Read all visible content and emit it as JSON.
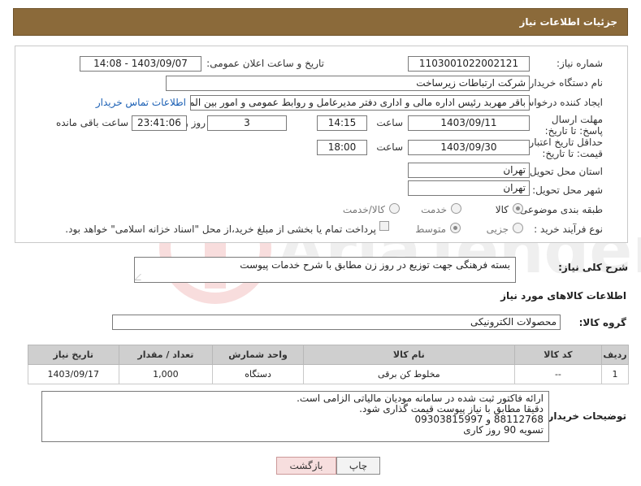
{
  "header": {
    "title": "جزئیات اطلاعات نیاز"
  },
  "form": {
    "need_number_label": "شماره نیاز:",
    "need_number": "1103001022002121",
    "announce_label": "تاریخ و ساعت اعلان عمومی:",
    "announce_value": "1403/09/07 - 14:08",
    "buyer_org_label": "نام دستگاه خریدار:",
    "buyer_org": "شرکت ارتباطات زیرساخت",
    "creator_label": "ایجاد کننده درخواست:",
    "creator": "باقر مهربد رئیس اداره مالی و اداری دفتر مدیرعامل و روابط عمومی و امور بین الم",
    "contact_link": "اطلاعات تماس خریدار",
    "deadline_label": "مهلت ارسال پاسخ: تا تاریخ:",
    "deadline_date": "1403/09/11",
    "time_label": "ساعت",
    "deadline_time": "14:15",
    "days_value": "3",
    "days_label": "روز و",
    "remaining_time": "23:41:06",
    "remaining_label": "ساعت باقی مانده",
    "validity_label": "حداقل تاریخ اعتبار قیمت: تا تاریخ:",
    "validity_date": "1403/09/30",
    "validity_time": "18:00",
    "province_label": "استان محل تحویل:",
    "province": "تهران",
    "city_label": "شهر محل تحویل:",
    "city": "تهران",
    "category_label": "طبقه بندی موضوعی:",
    "category_options": [
      "کالا",
      "خدمت",
      "کالا/خدمت"
    ],
    "process_label": "نوع فرآیند خرید :",
    "process_options": [
      "جزیی",
      "متوسط"
    ],
    "payment_note": "پرداخت تمام یا بخشی از مبلغ خرید،از محل \"اسناد خزانه اسلامی\" خواهد بود."
  },
  "description": {
    "label": "شرح کلی نیاز:",
    "text": "بسته فرهنگی جهت توزیع در روز زن مطابق با شرح خدمات پیوست"
  },
  "goods": {
    "section_title": "اطلاعات کالاهای مورد نیاز",
    "group_label": "گروه کالا:",
    "group_value": "محصولات الکترونیکی",
    "columns": [
      "ردیف",
      "کد کالا",
      "نام کالا",
      "واحد شمارش",
      "تعداد / مقدار",
      "تاریخ نیاز"
    ],
    "rows": [
      {
        "row": "1",
        "code": "--",
        "name": "مخلوط کن برقی",
        "unit": "دستگاه",
        "qty": "1,000",
        "date": "1403/09/17"
      }
    ]
  },
  "notes": {
    "label": "توضیحات خریدار:",
    "lines": [
      "ارائه فاکتور ثبت شده در سامانه مودیان مالیاتی الزامی است.",
      "دقیقا مطابق با نیاز پیوست قیمت گذاری شود.",
      "88112768 و 09303815997",
      "تسویه 90 روز کاری"
    ]
  },
  "buttons": {
    "print": "چاپ",
    "back": "بازگشت"
  },
  "watermark": {
    "text": "AriaTender.net"
  }
}
